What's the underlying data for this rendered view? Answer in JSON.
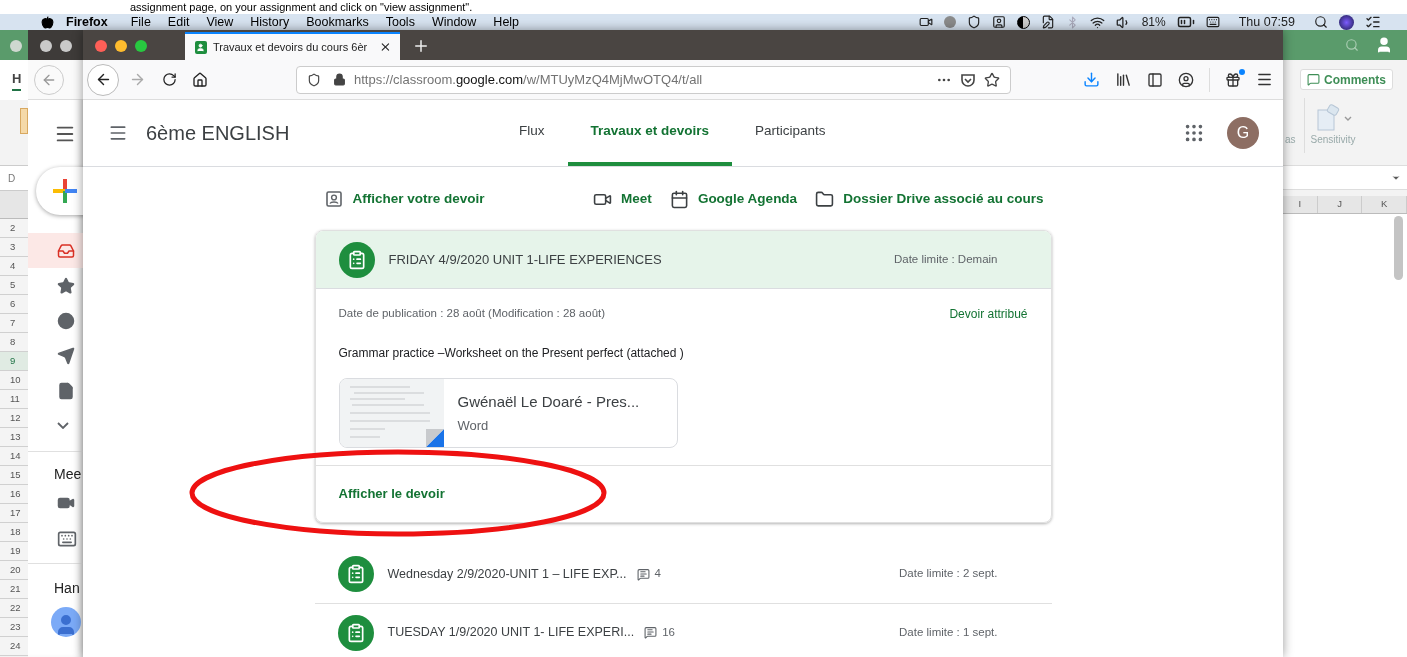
{
  "caption": "assignment page, on your assignment and click on \"view assignment\".",
  "menubar": {
    "app": "Firefox",
    "menus": [
      "File",
      "Edit",
      "View",
      "History",
      "Bookmarks",
      "Tools",
      "Window",
      "Help"
    ],
    "battery": "81%",
    "clock": "Thu 07:59"
  },
  "spreadsheet_left": {
    "tab": "H",
    "cell_ref": "D",
    "rows": [
      {
        "label": "2",
        "selected": false
      },
      {
        "label": "3",
        "selected": false
      },
      {
        "label": "4",
        "selected": false
      },
      {
        "label": "5",
        "selected": false
      },
      {
        "label": "6",
        "selected": false
      },
      {
        "label": "7",
        "selected": false
      },
      {
        "label": "8",
        "selected": false
      },
      {
        "label": "9",
        "selected": true
      },
      {
        "label": "10",
        "selected": false
      },
      {
        "label": "11",
        "selected": false
      },
      {
        "label": "12",
        "selected": false
      },
      {
        "label": "13",
        "selected": false
      },
      {
        "label": "14",
        "selected": false
      },
      {
        "label": "15",
        "selected": false
      },
      {
        "label": "16",
        "selected": false
      },
      {
        "label": "17",
        "selected": false
      },
      {
        "label": "18",
        "selected": false
      },
      {
        "label": "19",
        "selected": false
      },
      {
        "label": "20",
        "selected": false
      },
      {
        "label": "21",
        "selected": false
      },
      {
        "label": "22",
        "selected": false
      },
      {
        "label": "23",
        "selected": false
      },
      {
        "label": "24",
        "selected": false
      }
    ]
  },
  "mail_sidebar": {
    "nav_items": [
      {
        "kind": "inbox",
        "selected": true
      },
      {
        "kind": "starred",
        "selected": false
      },
      {
        "kind": "snoozed",
        "selected": false
      },
      {
        "kind": "sent",
        "selected": false
      },
      {
        "kind": "drafts",
        "selected": false
      },
      {
        "kind": "more",
        "selected": false
      }
    ],
    "meet_heading": "Mee",
    "meet_items": [
      {
        "kind": "video"
      },
      {
        "kind": "keyboard"
      }
    ],
    "hangouts_heading": "Han"
  },
  "browser": {
    "tab_title": "Travaux et devoirs du cours 6èr",
    "url": {
      "prefix": "https://classroom.",
      "domain": "google.com",
      "path": "/w/MTUyMzQ4MjMwOTQ4/t/all"
    }
  },
  "classroom": {
    "class_name": "6ème ENGLISH",
    "tabs": [
      {
        "label": "Flux",
        "selected": false
      },
      {
        "label": "Travaux et devoirs",
        "selected": true
      },
      {
        "label": "Participants",
        "selected": false
      }
    ],
    "avatar": "G",
    "your_work_link": "Afficher votre devoir",
    "class_links": [
      {
        "kind": "meet",
        "label": "Meet"
      },
      {
        "kind": "calendar",
        "label": "Google Agenda"
      },
      {
        "kind": "drive",
        "label": "Dossier Drive associé au cours"
      }
    ],
    "open_assignment": {
      "title": "FRIDAY 4/9/2020 UNIT 1-LIFE EXPERIENCES",
      "due": "Date limite : Demain",
      "posted": "Date de publication : 28 août (Modification : 28 août)",
      "status": "Devoir attribué",
      "description": "Grammar practice –Worksheet on the Present perfect (attached )",
      "attachment": {
        "name": "Gwénaël Le Doaré - Pres...",
        "type": "Word"
      },
      "view_link": "Afficher le devoir"
    },
    "assignments": [
      {
        "title": "Wednesday 2/9/2020-UNIT 1 – LIFE EXP...",
        "comments": "4",
        "due": "Date limite : 2 sept."
      },
      {
        "title": "TUESDAY 1/9/2020 UNIT 1- LIFE EXPERI...",
        "comments": "16",
        "due": "Date limite : 1 sept."
      }
    ]
  },
  "spreadsheet_right": {
    "comments_button": "Comments",
    "ribbon_partial": "as",
    "ribbon_item": "Sensitivity",
    "columns": [
      "I",
      "J",
      "K"
    ]
  }
}
